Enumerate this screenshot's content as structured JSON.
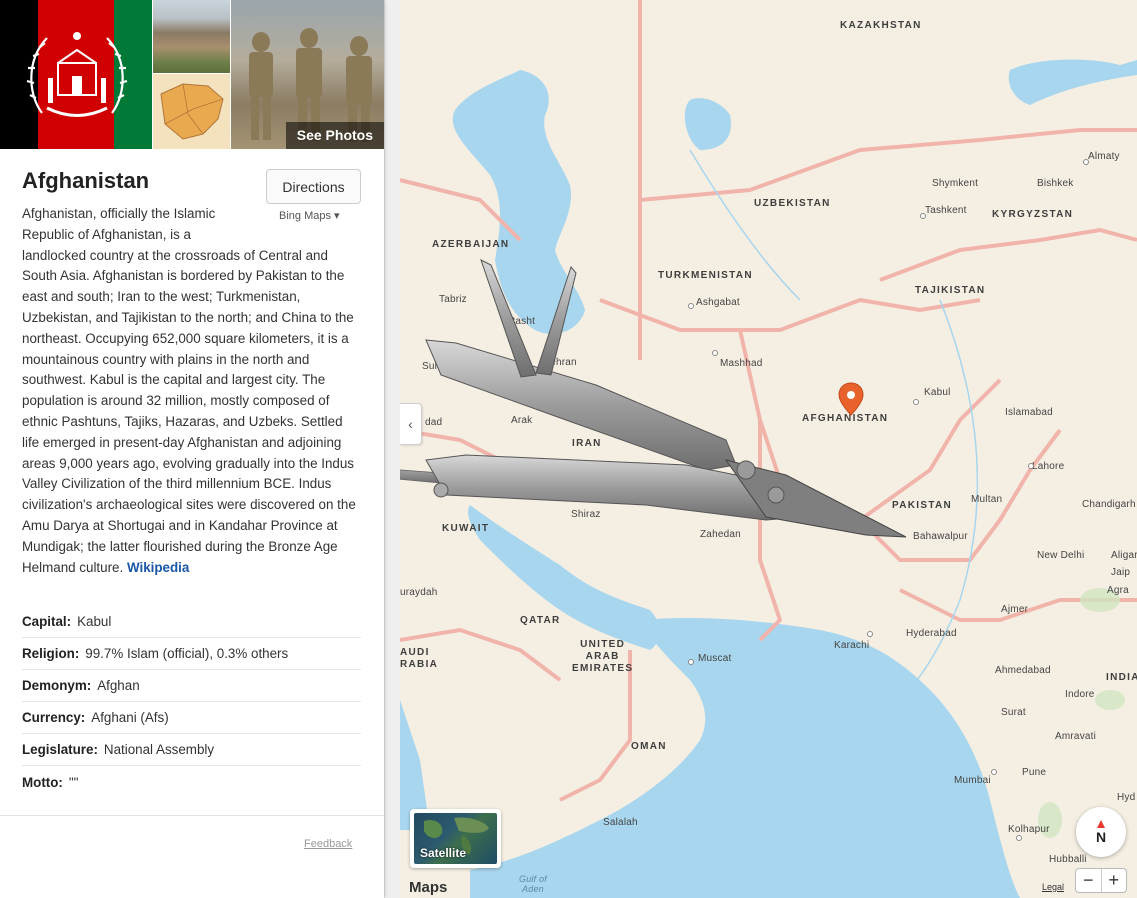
{
  "panel": {
    "see_photos": "See Photos",
    "title": "Afghanistan",
    "directions": "Directions",
    "bing_maps": "Bing Maps ▾",
    "description": "Afghanistan, officially the Islamic Republic of Afghanistan, is a landlocked country at the crossroads of Central and South Asia. Afghanistan is bordered by Pakistan to the east and south; Iran to the west; Turkmenistan, Uzbekistan, and Tajikistan to the north; and China to the northeast. Occupying 652,000 square kilometers, it is a mountainous country with plains in the north and southwest. Kabul is the capital and largest city. The population is around 32 million, mostly composed of ethnic Pashtuns, Tajiks, Hazaras, and Uzbeks. Settled life emerged in present-day Afghanistan and adjoining areas 9,000 years ago, evolving gradually into the Indus Valley Civilization of the third millennium BCE. Indus civilization's archaeological sites were discovered on the Amu Darya at Shortugai and in Kandahar Province at Mundigak; the latter flourished during the Bronze Age Helmand culture.",
    "wikipedia": "Wikipedia",
    "facts": [
      {
        "key": "Capital:",
        "value": "Kabul"
      },
      {
        "key": "Religion:",
        "value": "99.7% Islam (official), 0.3% others"
      },
      {
        "key": "Demonym:",
        "value": "Afghan"
      },
      {
        "key": "Currency:",
        "value": "Afghani (Afs)"
      },
      {
        "key": "Legislature:",
        "value": "National Assembly"
      },
      {
        "key": "Motto:",
        "value": "\"\""
      }
    ],
    "feedback": "Feedback",
    "collapse": "‹"
  },
  "map": {
    "satellite": "Satellite",
    "maps_logo": "Maps",
    "legal": "Legal",
    "compass": "N",
    "zoom_out": "−",
    "zoom_in": "+",
    "countries": {
      "kazakhstan": "KAZAKHSTAN",
      "uzbekistan": "UZBEKISTAN",
      "kyrgyzstan": "KYRGYZSTAN",
      "azerbaijan": "AZERBAIJAN",
      "turkmenistan": "TURKMENISTAN",
      "tajikistan": "TAJIKISTAN",
      "afghanistan": "AFGHANISTAN",
      "iran": "IRAN",
      "pakistan": "PAKISTAN",
      "kuwait": "KUWAIT",
      "qatar": "QATAR",
      "uae": "UNITED\nARAB\nEMIRATES",
      "saudi": "AUDI\nRABIA",
      "oman": "OMAN",
      "india": "INDIA"
    },
    "cities": {
      "almaty": "Almaty",
      "shymkent": "Shymkent",
      "bishkek": "Bishkek",
      "tashkent": "Tashkent",
      "ashgabat": "Ashgabat",
      "tabriz": "Tabriz",
      "rasht": "Rasht",
      "tehran": "Tehran",
      "mashhad": "Mashhad",
      "sulaymaniyah": "Sulaym",
      "baghdad": "dad",
      "arak": "Arak",
      "kabul": "Kabul",
      "islamabad": "Islamabad",
      "lahore": "Lahore",
      "chandigarh": "Chandigarh",
      "multan": "Multan",
      "bahawalpur": "Bahawalpur",
      "shiraz": "Shiraz",
      "zahedan": "Zahedan",
      "new_delhi": "New Delhi",
      "aligarh": "Aligar",
      "agra": "Agra",
      "jaipur": "Jaip",
      "ajmer": "Ajmer",
      "muraydah": "uraydah",
      "karachi": "Karachi",
      "hyderabad": "Hyderabad",
      "muscat": "Muscat",
      "ahmedabad": "Ahmedabad",
      "indore": "Indore",
      "surat": "Surat",
      "amravati": "Amravati",
      "mumbai": "Mumbai",
      "pune": "Pune",
      "salalah": "Salalah",
      "kolhapur": "Kolhapur",
      "hubballi": "Hubballi",
      "hyd_india": "Hyd"
    },
    "water": {
      "gulf_of_aden": "Gulf of\nAden"
    }
  }
}
